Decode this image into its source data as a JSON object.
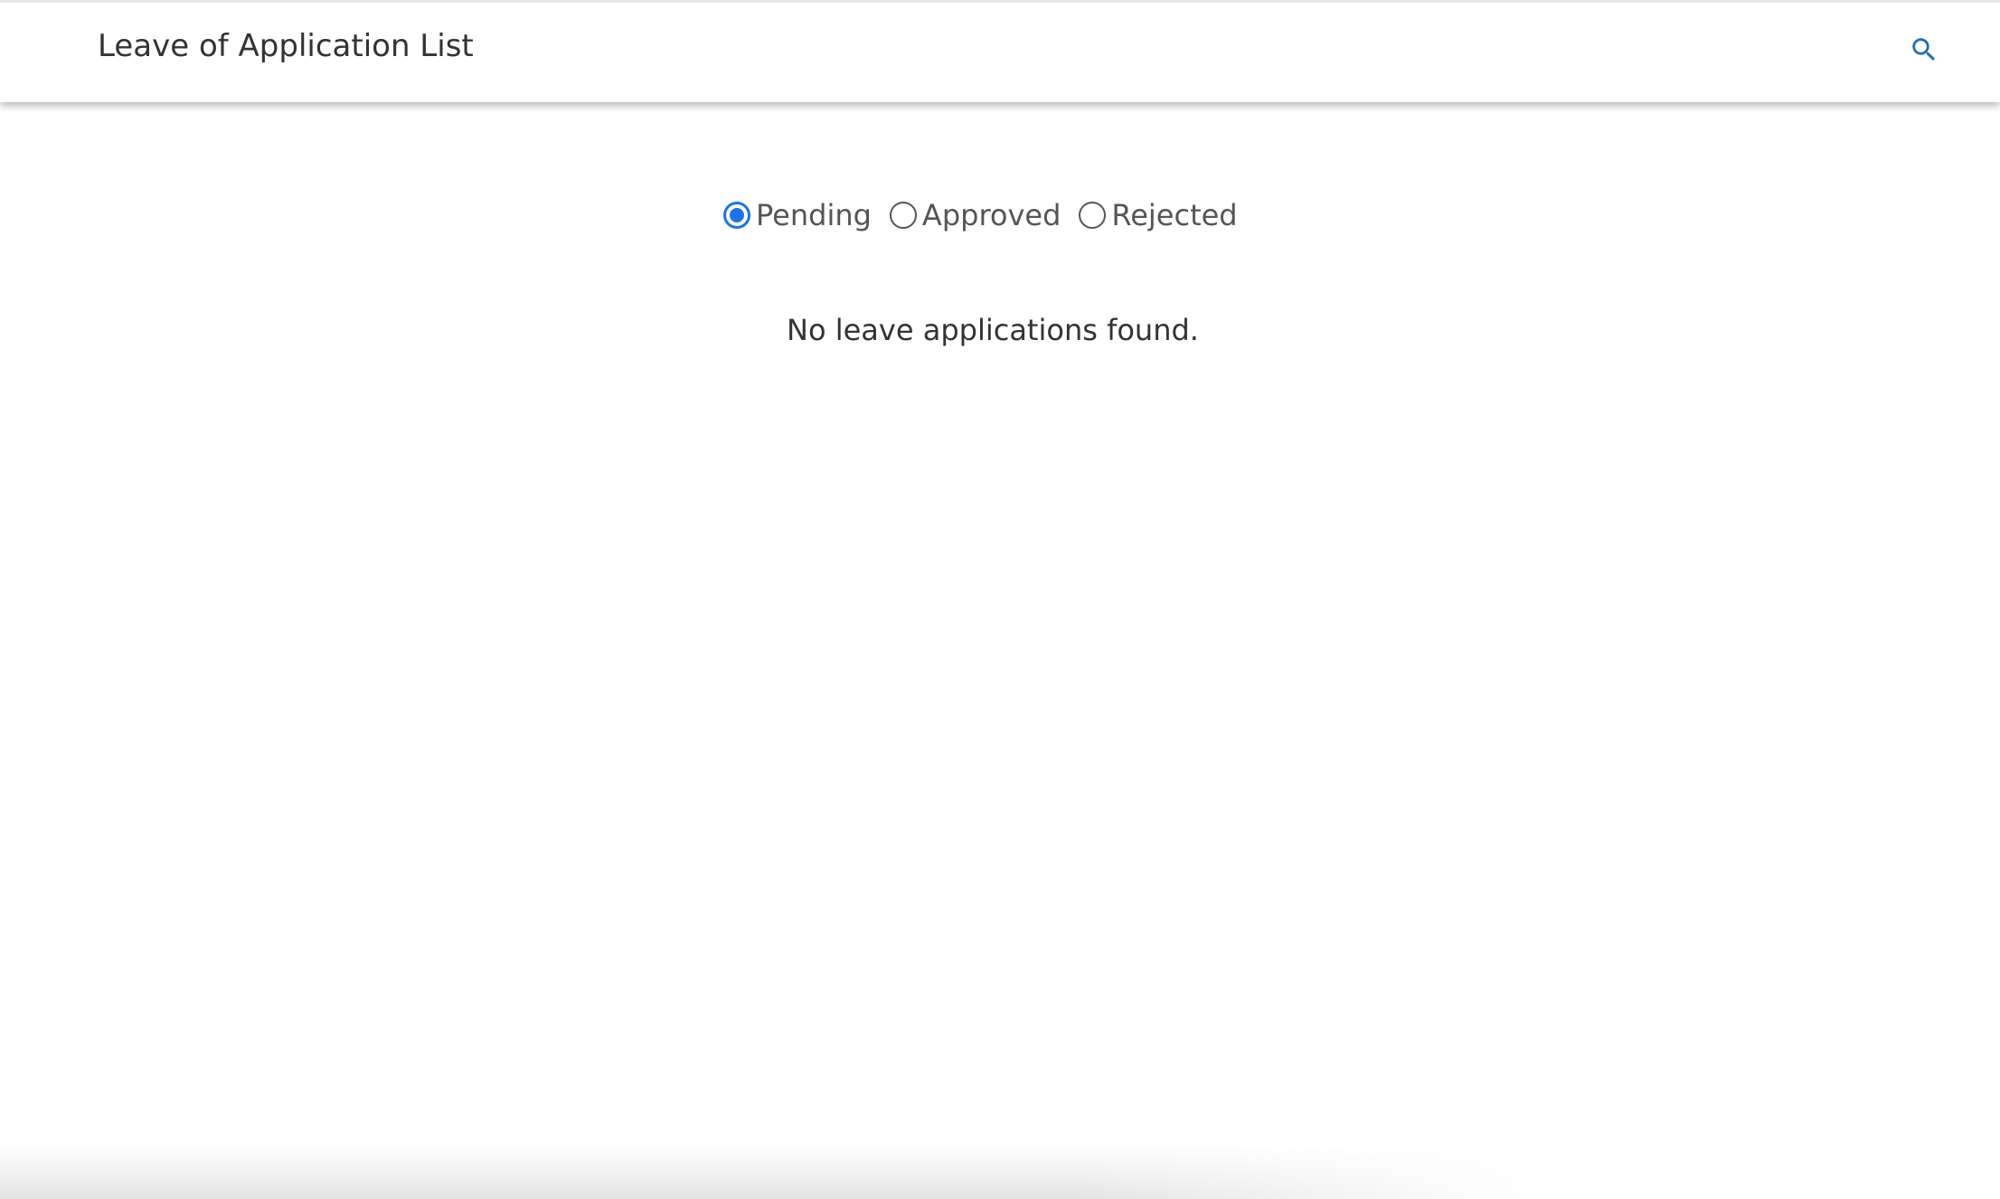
{
  "header": {
    "title": "Leave of Application List",
    "search_icon": "search-icon"
  },
  "filters": {
    "options": [
      {
        "label": "Pending",
        "checked": true
      },
      {
        "label": "Approved",
        "checked": false
      },
      {
        "label": "Rejected",
        "checked": false
      }
    ],
    "selected_color": "#1a73e8"
  },
  "content": {
    "empty_message": "No leave applications found."
  },
  "colors": {
    "accent": "#1a73e8",
    "icon": "#1f6fb2",
    "text": "#333333"
  }
}
